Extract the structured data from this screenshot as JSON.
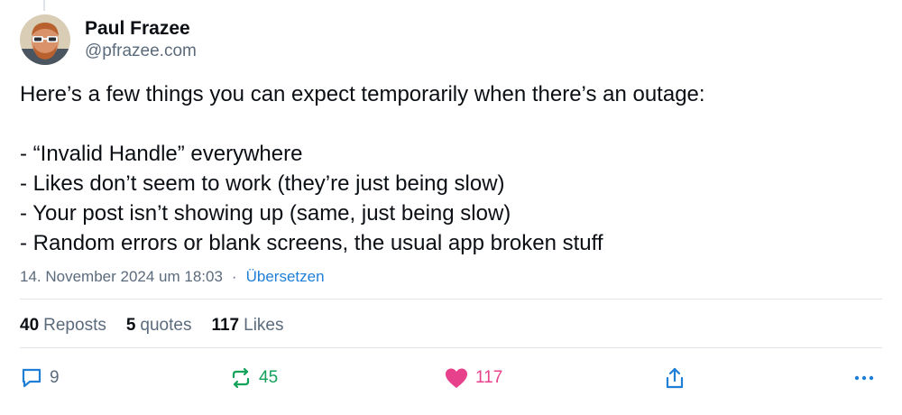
{
  "author": {
    "display_name": "Paul Frazee",
    "handle": "@pfrazee.com"
  },
  "post": {
    "lines": [
      "Here’s a few things you can expect temporarily when there’s an outage:",
      "",
      "- “Invalid Handle” everywhere",
      "- Likes don’t seem to work (they’re just being slow)",
      "- Your post isn’t showing up (same, just being slow)",
      "- Random errors or blank screens, the usual app broken stuff"
    ],
    "timestamp": "14. November 2024 um 18:03",
    "separator": "·",
    "translate_label": "Übersetzen"
  },
  "stats": {
    "reposts_count": "40",
    "reposts_label": "Reposts",
    "quotes_count": "5",
    "quotes_label": "quotes",
    "likes_count": "117",
    "likes_label": "Likes"
  },
  "actions": {
    "reply_count": "9",
    "repost_count": "45",
    "like_count": "117"
  },
  "colors": {
    "text": "#0b0f14",
    "muted": "#5b6b7c",
    "link": "#1f7fd6",
    "repost_active": "#13a25a",
    "like_active": "#e8418b",
    "divider": "#dfe3e8"
  },
  "icons": {
    "reply": "speech-bubble-icon",
    "repost": "repost-arrows-icon",
    "like": "heart-icon",
    "share": "share-icon",
    "more": "ellipsis-icon"
  }
}
